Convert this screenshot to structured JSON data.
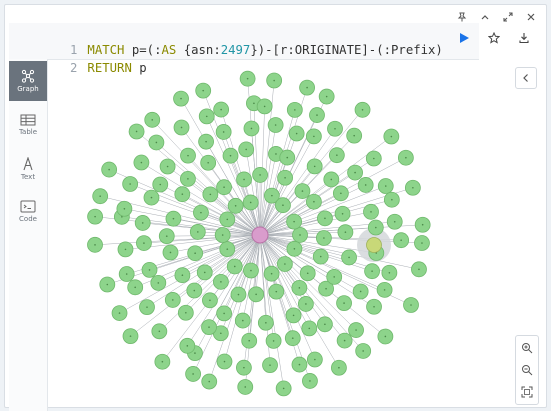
{
  "window_controls": [
    "pin-icon",
    "minimize-icon",
    "expand-icon",
    "close-icon"
  ],
  "editor": {
    "lines": [
      {
        "number": "1",
        "tokens": [
          {
            "text": "MATCH",
            "kind": "kw"
          },
          {
            "text": " p=(:",
            "kind": "txt"
          },
          {
            "text": "AS",
            "kind": "kw"
          },
          {
            "text": " {asn:",
            "kind": "txt"
          },
          {
            "text": "2497",
            "kind": "num"
          },
          {
            "text": "})-[r:ORIGINATE]-(:Prefix)",
            "kind": "txt"
          }
        ]
      },
      {
        "number": "2",
        "tokens": [
          {
            "text": "RETURN",
            "kind": "kw"
          },
          {
            "text": " p",
            "kind": "txt"
          }
        ]
      }
    ]
  },
  "actions": [
    "run-icon",
    "star-icon",
    "download-icon"
  ],
  "sidebar": {
    "items": [
      {
        "label": "Graph",
        "icon": "graph-icon",
        "active": true
      },
      {
        "label": "Table",
        "icon": "table-icon",
        "active": false
      },
      {
        "label": "Text",
        "icon": "text-icon",
        "active": false
      },
      {
        "label": "Code",
        "icon": "code-icon",
        "active": false
      }
    ]
  },
  "graph": {
    "center_node_color": "#d99ccc",
    "prefix_node_color": "#8dd48b",
    "prefix_node_stroke": "#6fb86c",
    "prefix_node_count": 160,
    "selected_node_halo": "#d4d7db"
  },
  "zoom_controls": [
    "zoom-in-icon",
    "zoom-out-icon",
    "fit-icon"
  ],
  "colors": {
    "run": "#1a73e8",
    "active_tab": "#6a737d"
  }
}
